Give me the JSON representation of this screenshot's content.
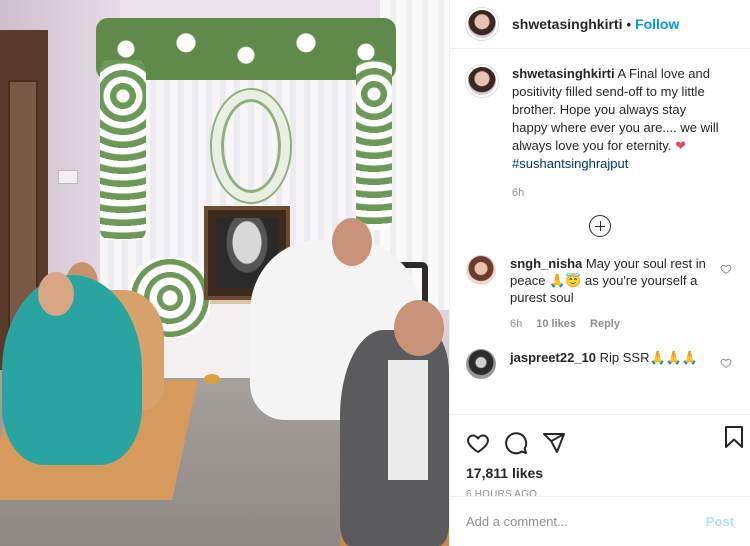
{
  "post": {
    "username": "shwetasinghkirti",
    "follow_label": "Follow",
    "separator": "•"
  },
  "caption": {
    "username": "shwetasinghkirti",
    "text": "A Final love and positivity filled send-off to my little brother. Hope you always stay happy where ever you are.... we will always love you for eternity.",
    "heart": "❤",
    "hashtag": "#sushantsinghrajput",
    "time": "6h"
  },
  "comments": [
    {
      "username": "sngh_nisha",
      "text": "May your soul rest in peace 🙏😇 as you're yourself a purest soul",
      "time": "6h",
      "likes": "10 likes",
      "reply": "Reply"
    },
    {
      "username": "jaspreet22_10",
      "text": "Rip SSR🙏🙏🙏"
    }
  ],
  "stats": {
    "likes": "17,811 likes",
    "posted": "6 HOURS AGO"
  },
  "composer": {
    "placeholder": "Add a comment...",
    "post_label": "Post"
  },
  "icons": {
    "like": "heart-outline",
    "comment": "speech-bubble",
    "share": "paper-plane",
    "save": "bookmark",
    "more": "ellipsis",
    "load_more": "plus-circle"
  },
  "colors": {
    "link": "#0095f6",
    "hashtag": "#00376b",
    "muted": "#8e8e8e",
    "heart": "#ed4956",
    "post_disabled": "#b2dffc"
  }
}
